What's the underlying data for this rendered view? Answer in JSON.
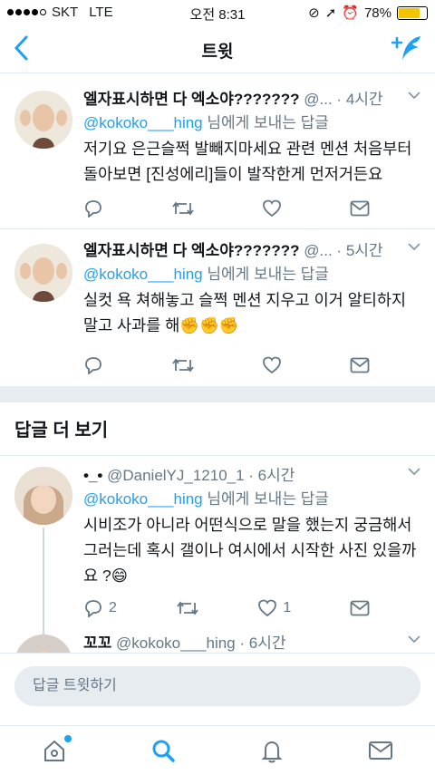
{
  "status": {
    "carrier": "SKT",
    "network": "LTE",
    "time": "오전 8:31",
    "battery": "78%",
    "battery_level": 0.78
  },
  "nav": {
    "title": "트윗",
    "back_icon": "chevron-left-icon",
    "compose_icon": "compose-tweet-icon"
  },
  "tweets": [
    {
      "name": "엘자표시하면 다 엑소야???????",
      "meta": "@... · 4시간",
      "reply_mention": "@kokoko___hing",
      "reply_suffix": " 님에게 보내는 답글",
      "text": "저기요 은근슬쩍 발빼지마세요 관련 멘션 처음부터 돌아보면 [진성에리]들이 발작한게 먼저거든요"
    },
    {
      "name": "엘자표시하면 다 엑소야???????",
      "meta": "@... · 5시간",
      "reply_mention": "@kokoko___hing",
      "reply_suffix": " 님에게 보내는 답글",
      "text": "실컷 욕 쳐해놓고 슬쩍 멘션 지우고 이거 알티하지 말고 사과를 해✊✊✊"
    }
  ],
  "more_replies_title": "답글 더 보기",
  "replies": [
    {
      "name": "•_•",
      "meta": "@DanielYJ_1210_1 · 6시간",
      "reply_mention": "@kokoko___hing",
      "reply_suffix": " 님에게 보내는 답글",
      "text": "시비조가 아니라 어떤식으로 말을 했는지 궁금해서 그러는데 혹시 갤이나 여시에서 시작한 사진 있을까요 ?😄",
      "reply_count": "2",
      "like_count": "1"
    },
    {
      "name": "꼬꼬",
      "meta": "@kokoko___hing · 6시간"
    }
  ],
  "reply_bar": {
    "placeholder": "답글 트윗하기"
  },
  "tabs": [
    "home-icon",
    "search-icon",
    "notifications-icon",
    "messages-icon"
  ],
  "colors": {
    "accent": "#1da1f2",
    "muted": "#657786",
    "divider": "#e6ecf0"
  }
}
